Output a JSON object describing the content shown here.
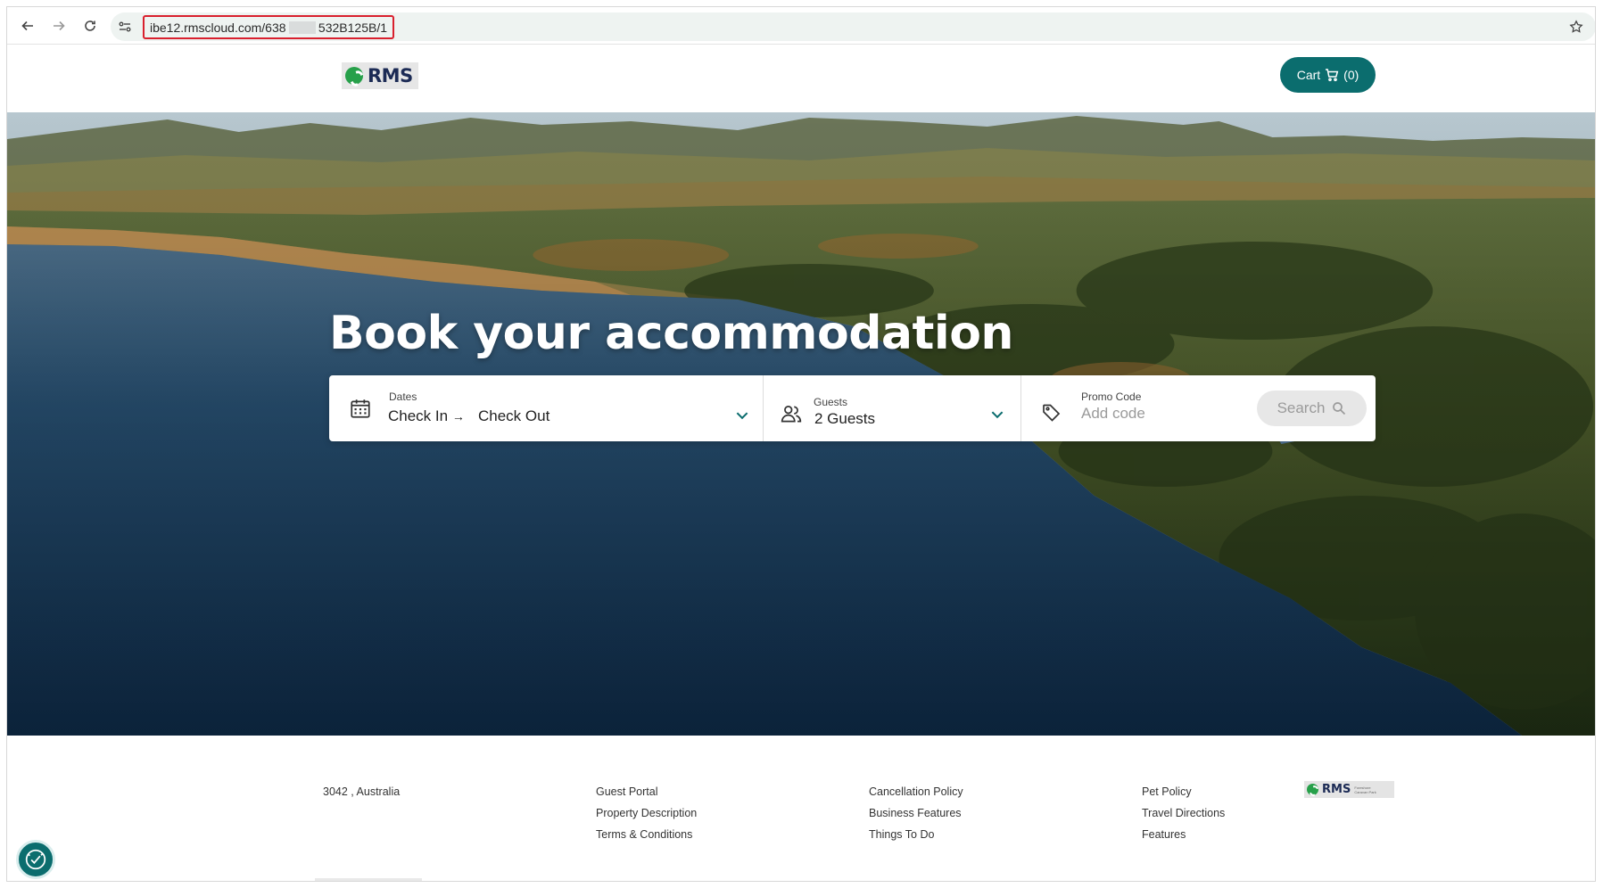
{
  "browser": {
    "url_prefix": "ibe12.rmscloud.com/638",
    "url_suffix": "532B125B/1",
    "back_icon": "back-arrow-icon",
    "forward_icon": "forward-arrow-icon",
    "reload_icon": "reload-icon",
    "bookmark_icon": "star-icon"
  },
  "header": {
    "logo_text": "RMS",
    "cart_label": "Cart",
    "cart_count": "(0)"
  },
  "hero": {
    "title": "Book your accommodation"
  },
  "search": {
    "dates_label": "Dates",
    "check_in": "Check In",
    "check_in_arrow": "→",
    "check_out": "Check Out",
    "guests_label": "Guests",
    "guests_value": "2 Guests",
    "promo_label": "Promo Code",
    "promo_placeholder": "Add code",
    "search_label": "Search"
  },
  "footer": {
    "address": "3042 , Australia",
    "col1": [
      "Guest Portal",
      "Property Description",
      "Terms & Conditions"
    ],
    "col2": [
      "Cancellation Policy",
      "Business Features",
      "Things To Do"
    ],
    "col3": [
      "Pet Policy",
      "Travel Directions",
      "Features"
    ],
    "logo_text": "RMS",
    "logo_subtext": "Foreshore Caravan Park"
  },
  "colors": {
    "accent": "#0b6d6e",
    "url_highlight": "#d9202e",
    "logo_navy": "#1c2b55",
    "logo_green": "#27a04a"
  }
}
